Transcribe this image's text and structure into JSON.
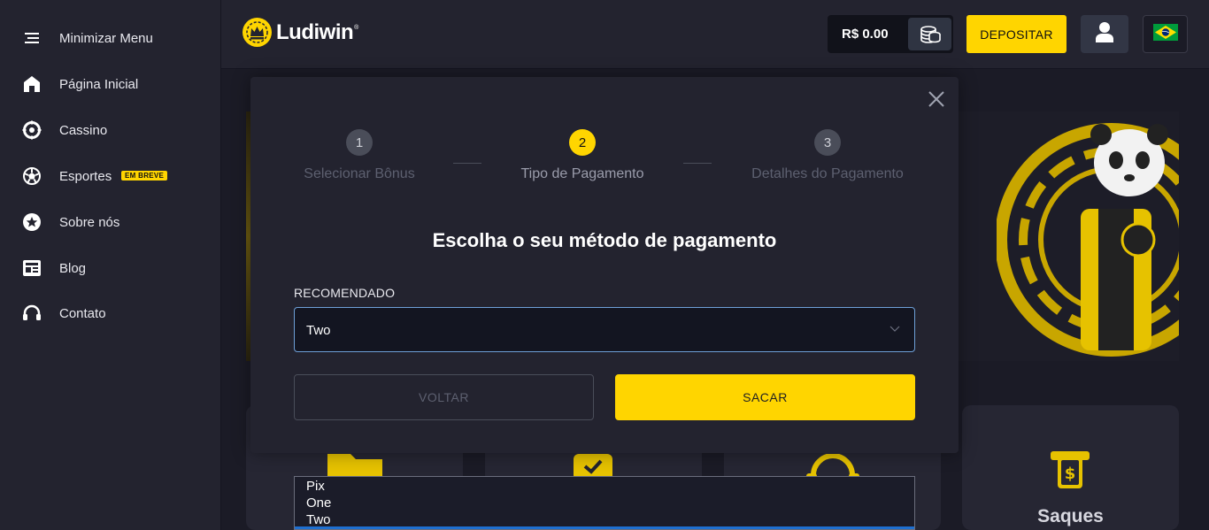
{
  "sidebar": {
    "items": [
      {
        "label": "Minimizar Menu",
        "icon": "menu-icon"
      },
      {
        "label": "Página Inicial",
        "icon": "home-icon"
      },
      {
        "label": "Cassino",
        "icon": "casino-chip-icon"
      },
      {
        "label": "Esportes",
        "icon": "soccer-ball-icon",
        "badge": "EM BREVE"
      },
      {
        "label": "Sobre nós",
        "icon": "star-icon"
      },
      {
        "label": "Blog",
        "icon": "newspaper-icon"
      },
      {
        "label": "Contato",
        "icon": "headset-icon"
      }
    ]
  },
  "header": {
    "logo_text": "Ludiwin",
    "logo_reg": "®",
    "balance": "R$ 0.00",
    "deposit_label": "DEPOSITAR"
  },
  "modal": {
    "steps": [
      {
        "number": "1",
        "label": "Selecionar Bônus",
        "state": "done"
      },
      {
        "number": "2",
        "label": "Tipo de Pagamento",
        "state": "active"
      },
      {
        "number": "3",
        "label": "Detalhes do Pagamento",
        "state": "pending"
      }
    ],
    "heading": "Escolha o seu método de pagamento",
    "recommended_label": "RECOMENDADO",
    "selected_value": "Two",
    "back_label": "VOLTAR",
    "submit_label": "SACAR"
  },
  "dropdown": {
    "options": [
      "Pix",
      "One",
      "Two"
    ]
  },
  "background": {
    "card_label": "Saques"
  },
  "colors": {
    "accent": "#ffd500",
    "sidebar_bg": "#23232f",
    "page_bg": "#1b1b26"
  }
}
